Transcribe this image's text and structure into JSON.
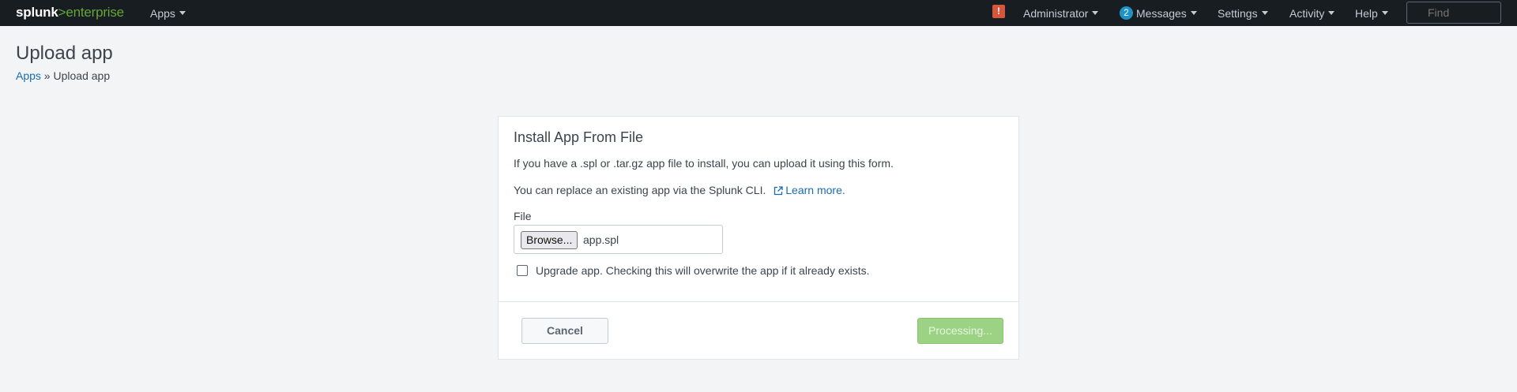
{
  "topbar": {
    "logo_splunk": "splunk",
    "logo_product": ">enterprise",
    "apps_label": "Apps",
    "alert_glyph": "!",
    "admin_label": "Administrator",
    "messages_count": "2",
    "messages_label": "Messages",
    "settings_label": "Settings",
    "activity_label": "Activity",
    "help_label": "Help",
    "find_placeholder": "Find"
  },
  "page": {
    "title": "Upload app",
    "breadcrumb_link": "Apps",
    "breadcrumb_sep": " » ",
    "breadcrumb_current": "Upload app"
  },
  "panel": {
    "title": "Install App From File",
    "line1": "If you have a .spl or .tar.gz app file to install, you can upload it using this form.",
    "line2": "You can replace an existing app via the Splunk CLI.",
    "learn_more": "Learn more.",
    "file_label": "File",
    "browse_label": "Browse...",
    "file_name": "app.spl",
    "upgrade_label": "Upgrade app. Checking this will overwrite the app if it already exists.",
    "upgrade_checked": false,
    "cancel_label": "Cancel",
    "processing_label": "Processing..."
  },
  "colors": {
    "topbar_bg": "#171d21",
    "brand_green": "#65a637",
    "link_blue": "#1a6cb0",
    "alert_red": "#d6563c",
    "badge_blue": "#1e93c6",
    "processing_green": "#9bd283"
  },
  "icons": {
    "alert": "alert-icon",
    "external_link": "external-link-icon",
    "search": "search-icon"
  }
}
